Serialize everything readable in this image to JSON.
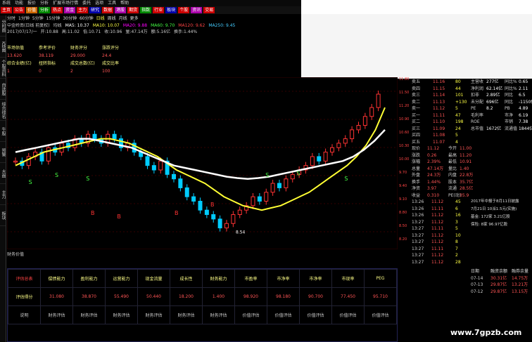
{
  "menubar": [
    "系统",
    "功能",
    "报价",
    "分析",
    "扩展市场行情",
    "委托",
    "选项",
    "工具",
    "帮助"
  ],
  "toolbar": [
    {
      "label": "主页",
      "color": "#c00"
    },
    {
      "label": "公告",
      "color": "#c00"
    },
    {
      "label": "价值",
      "color": "#c60"
    },
    {
      "label": "分析",
      "color": "#080"
    },
    {
      "label": "热点",
      "color": "#c00"
    },
    {
      "label": "资金",
      "color": "#a0a"
    },
    {
      "label": "主力",
      "color": "#c00"
    },
    {
      "label": "研究",
      "color": "#00a"
    },
    {
      "label": "数据",
      "color": "#c00"
    },
    {
      "label": "港股",
      "color": "#a0a"
    },
    {
      "label": "期货",
      "color": "#c00"
    },
    {
      "label": "指数",
      "color": "#080"
    },
    {
      "label": "行业",
      "color": "#c00"
    },
    {
      "label": "板块",
      "color": "#00a"
    },
    {
      "label": "个股",
      "color": "#c00"
    },
    {
      "label": "资讯",
      "color": "#a0a"
    },
    {
      "label": "交易",
      "color": "#c00"
    }
  ],
  "sidebar": [
    "分时图",
    "K线图",
    "个股资料",
    "自选股",
    "综合排名",
    "牛股",
    "预警",
    "大盘",
    "主力",
    "板块"
  ],
  "periods": {
    "items": [
      "分时",
      "1分钟",
      "5分钟",
      "15分钟",
      "30分钟",
      "60分钟",
      "日线",
      "周线",
      "月线",
      "更多"
    ],
    "active": 6
  },
  "info1": [
    "中金岭南(日线 前复权)",
    "均线",
    "MA5: 10.37",
    "MA10: 10.07",
    "MA20: 9.88",
    "MA60: 9.70",
    "MA120: 9.62",
    "MA250: 9.45"
  ],
  "info2": [
    "2017/07/17/一",
    "开:10.88",
    "高:11.02",
    "低:10.71",
    "收:10.96",
    "量:47.14万",
    "额:5.16亿",
    "换手:1.44%"
  ],
  "indicator": {
    "headers": [
      "市场估值",
      "参考评价",
      "财务评分",
      "涨跌评分"
    ],
    "values": [
      "13.620",
      "38.119",
      "29.000",
      "24.4"
    ],
    "headers2": [
      "综合业绩(亿)",
      "扭转指标",
      "成交总数(亿)",
      "成交比率"
    ],
    "values2": [
      "1",
      "0",
      "2",
      "100"
    ]
  },
  "chart_data": {
    "type": "candlestick",
    "price_scale": [
      "11.80",
      "11.50",
      "11.20",
      "10.90",
      "10.60",
      "10.30",
      "10.00",
      "9.70",
      "9.40",
      "9.10",
      "8.80",
      "8.50",
      "8.20"
    ],
    "signals": {
      "S": [
        [
          9,
          0.62
        ],
        [
          20,
          0.58
        ],
        [
          33,
          0.6
        ],
        [
          108,
          0.58
        ],
        [
          121,
          0.57
        ],
        [
          141,
          0.6
        ]
      ],
      "B": [
        [
          35,
          0.8
        ],
        [
          46,
          0.82
        ],
        [
          70,
          0.8
        ],
        [
          85,
          0.75
        ]
      ]
    },
    "low_label": "8.54",
    "candles": [
      10.1,
      10.0,
      10.2,
      10.3,
      10.1,
      10.4,
      10.3,
      10.5,
      10.4,
      10.6,
      10.5,
      10.7,
      10.6,
      10.5,
      10.7,
      10.6,
      10.4,
      10.5,
      10.3,
      10.2,
      10.0,
      9.9,
      10.1,
      9.8,
      9.7,
      9.5,
      9.3,
      9.2,
      9.0,
      8.9,
      8.8,
      8.6,
      8.7,
      8.9,
      9.0,
      9.1,
      9.3,
      9.2,
      9.4,
      9.6,
      9.5,
      9.7,
      9.8,
      9.9,
      10.0,
      10.2,
      10.1,
      10.3,
      10.4,
      10.5,
      10.6,
      10.8,
      10.9,
      11.1,
      11.3,
      11.6
    ],
    "ma_yellow": [
      10.0,
      10.1,
      10.2,
      10.3,
      10.35,
      10.4,
      10.45,
      10.5,
      10.55,
      10.6,
      10.6,
      10.55,
      10.5,
      10.4,
      10.3,
      10.2,
      10.05,
      9.9,
      9.8,
      9.7,
      9.6,
      9.45,
      9.3,
      9.2,
      9.1,
      9.05,
      9.0,
      9.05,
      9.1,
      9.2,
      9.3,
      9.4,
      9.55,
      9.7,
      9.85,
      10.0,
      10.2,
      10.45,
      10.8,
      11.3
    ],
    "ma_white": [
      10.3,
      10.35,
      10.4,
      10.45,
      10.5,
      10.55,
      10.6,
      10.6,
      10.55,
      10.5,
      10.45,
      10.4,
      10.3,
      10.2,
      10.1,
      10.0,
      9.95,
      9.9,
      9.85,
      9.8,
      9.75,
      9.72,
      9.7,
      9.72,
      9.75,
      9.8,
      9.85,
      9.9,
      9.95,
      10.0,
      10.05,
      10.1,
      10.2,
      10.35,
      10.55,
      10.8
    ]
  },
  "quote": {
    "sell": [
      [
        "卖五",
        "11.16",
        "80"
      ],
      [
        "卖四",
        "11.15",
        "44"
      ],
      [
        "卖三",
        "11.14",
        "101"
      ],
      [
        "卖二",
        "11.13",
        "+130"
      ],
      [
        "卖一",
        "11.12",
        "5"
      ]
    ],
    "buy": [
      [
        "买一",
        "11.11",
        "47"
      ],
      [
        "买二",
        "11.10",
        "198"
      ],
      [
        "买三",
        "11.09",
        "24"
      ],
      [
        "买四",
        "11.08",
        "5"
      ],
      [
        "买五",
        "11.07",
        "4"
      ]
    ],
    "stats": [
      [
        "现价",
        "11.12",
        "今开",
        "11.00"
      ],
      [
        "涨跌",
        "0.26",
        "最高",
        "11.20"
      ],
      [
        "涨幅",
        "2.39%",
        "最低",
        "10.91"
      ],
      [
        "总量",
        "47.14万",
        "量比",
        "1.40"
      ],
      [
        "外盘",
        "24.3万",
        "内盘",
        "22.8万"
      ],
      [
        "换手",
        "1.44%",
        "股本",
        "35.7亿"
      ],
      [
        "净资",
        "3.97",
        "流通",
        "28.5亿"
      ],
      [
        "收益",
        "0.310",
        "PE(动)",
        "35.9"
      ]
    ],
    "fin": [
      [
        "主营收",
        "277亿",
        "同比%",
        "0.65"
      ],
      [
        "净利润",
        "62.14亿",
        "同比%",
        "2.11"
      ],
      [
        "扣非",
        "2.89亿",
        "同比",
        "6.5"
      ],
      [
        "未分配",
        "696亿",
        "同比",
        "-1150亿"
      ],
      [
        "PE",
        "8.2",
        "PB",
        "4.89"
      ],
      [
        "毛利率",
        "",
        "市净",
        "6.19"
      ],
      [
        "ROE",
        "",
        "市销",
        "7.38"
      ],
      [
        "总市值",
        "1672亿",
        "流通值",
        "1844亿"
      ]
    ],
    "ticks": [
      [
        "13:26",
        "11.12",
        "45"
      ],
      [
        "13:26",
        "11.11",
        "6"
      ],
      [
        "13:26",
        "11.12",
        "16"
      ],
      [
        "13:27",
        "11.12",
        "3"
      ],
      [
        "13:27",
        "11.11",
        "5"
      ],
      [
        "13:27",
        "11.12",
        "10"
      ],
      [
        "13:27",
        "11.12",
        "8"
      ],
      [
        "13:27",
        "11.11",
        "7"
      ],
      [
        "13:27",
        "11.12",
        "2"
      ],
      [
        "13:27",
        "11.12",
        "28"
      ]
    ],
    "notes": [
      "2017年中报于8月11日披露",
      "7月21日 10派1.5元(实施)",
      "基金: 172家 3.21亿股",
      "保险: 8家 96.97亿股"
    ],
    "margin": {
      "head": [
        "日期",
        "融资余额",
        "融券余量"
      ],
      "rows": [
        [
          "07-14",
          "30.31亿",
          "14.75万"
        ],
        [
          "07-13",
          "29.87亿",
          "13.21万"
        ],
        [
          "07-12",
          "29.87亿",
          "13.15万"
        ]
      ]
    }
  },
  "bottom": {
    "title": "财务价值",
    "headers": [
      "评估总表",
      "偿债能力",
      "盈利能力",
      "运营能力",
      "现金流量",
      "成长性",
      "财务能力",
      "市盈率",
      "市净率",
      "市净率",
      "市现率",
      "PEG"
    ],
    "scores_label": "评估得分",
    "scores": [
      "",
      "31.080",
      "38.870",
      "55.490",
      "50.440",
      "18.200",
      "1.400",
      "98.920",
      "98.180",
      "90.700",
      "77.450",
      "95.710"
    ],
    "foot_label": "说明",
    "foot": [
      "明",
      "财务评估",
      "财务评估",
      "财务评估",
      "财务评估",
      "财务评估",
      "财务评估",
      "价值评估",
      "价值评估",
      "价值评估",
      "价值评估",
      "价值评估"
    ]
  },
  "watermark": "www.7gpzb.com"
}
